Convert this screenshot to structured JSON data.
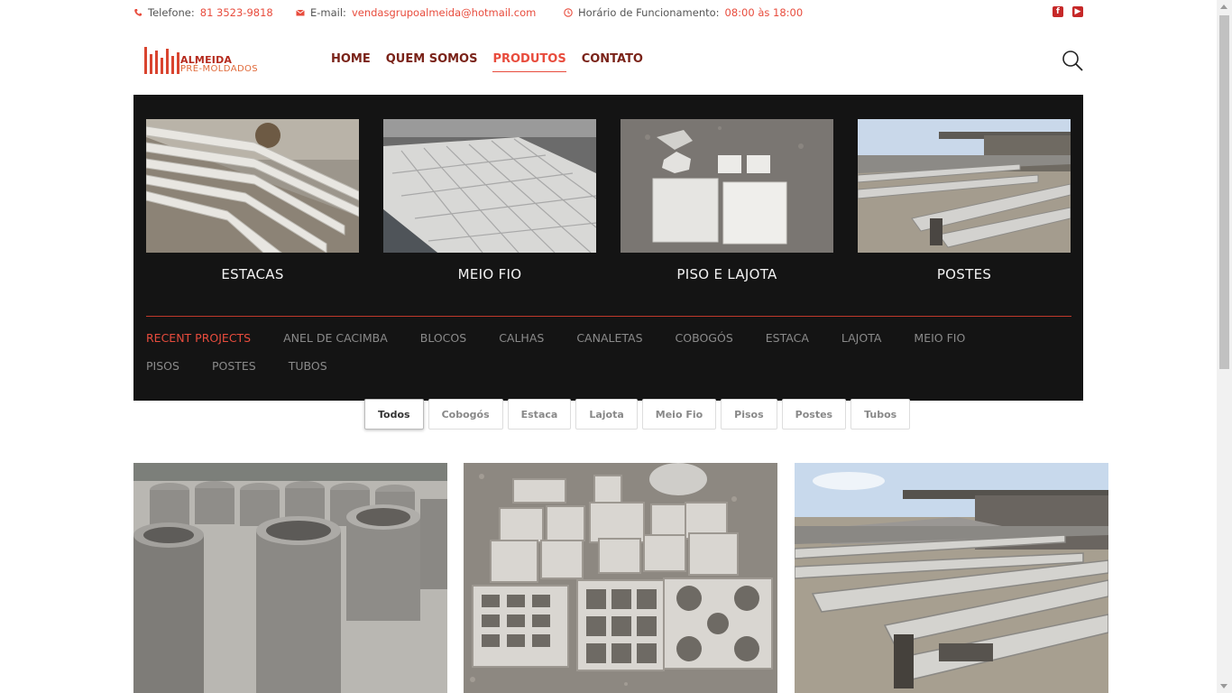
{
  "topbar": {
    "phone_label": "Telefone:",
    "phone": "81 3523-9818",
    "email_label": "E-mail:",
    "email": "vendasgrupoalmeida@hotmail.com",
    "hours_label": "Horário de Funcionamento:",
    "hours": "08:00 às 18:00",
    "social": [
      "facebook-icon",
      "youtube-icon"
    ]
  },
  "logo": {
    "line1": "ALMEIDA",
    "line2": "PRÉ-MOLDADOS"
  },
  "nav": {
    "items": [
      {
        "label": "HOME"
      },
      {
        "label": "QUEM SOMOS"
      },
      {
        "label": "PRODUTOS",
        "active": true
      },
      {
        "label": "CONTATO"
      }
    ]
  },
  "mega": {
    "categories": [
      {
        "label": "ESTACAS"
      },
      {
        "label": "MEIO FIO"
      },
      {
        "label": "PISO E LAJOTA"
      },
      {
        "label": "POSTES"
      }
    ],
    "links_row1": [
      "RECENT PROJECTS",
      "ANEL DE CACIMBA",
      "BLOCOS",
      "CALHAS",
      "CANALETAS",
      "COBOGÓS",
      "ESTACA",
      "LAJOTA",
      "MEIO FIO"
    ],
    "links_row2": [
      "PISOS",
      "POSTES",
      "TUBOS"
    ]
  },
  "filters": [
    "Todos",
    "Cobogós",
    "Estaca",
    "Lajota",
    "Meio Fio",
    "Pisos",
    "Postes",
    "Tubos"
  ],
  "colors": {
    "accent": "#e84c3d",
    "dark": "#141414",
    "brand_dark": "#7a2319"
  }
}
